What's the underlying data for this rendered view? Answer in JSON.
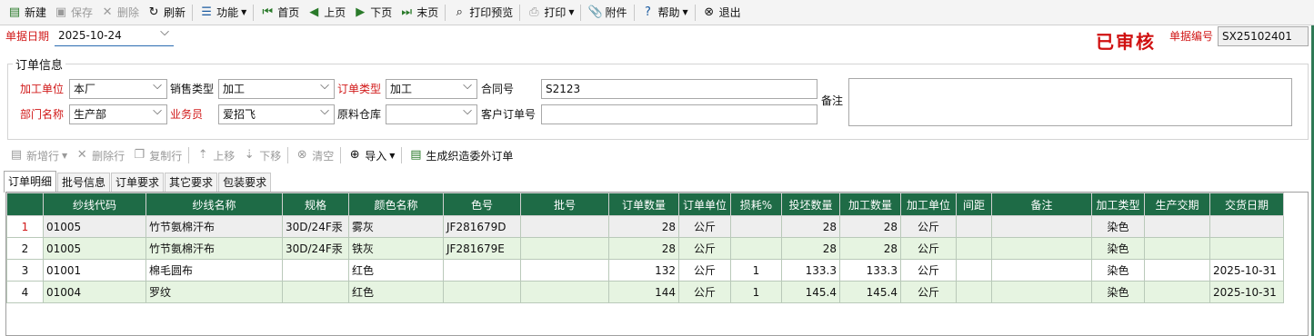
{
  "toolbar": {
    "new": "新建",
    "save": "保存",
    "delete": "删除",
    "refresh": "刷新",
    "function": "功能",
    "first": "首页",
    "prev": "上页",
    "next": "下页",
    "last": "末页",
    "print_preview": "打印预览",
    "print": "打印",
    "attachment": "附件",
    "help": "帮助",
    "exit": "退出"
  },
  "header": {
    "doc_date_label": "单据日期",
    "doc_date_value": "2025-10-24",
    "status_stamp": "已审核",
    "doc_no_label": "单据编号",
    "doc_no_value": "SX25102401"
  },
  "order_info": {
    "legend": "订单信息",
    "processing_unit_label": "加工单位",
    "processing_unit_value": "本厂",
    "sales_type_label": "销售类型",
    "sales_type_value": "加工",
    "order_type_label": "订单类型",
    "order_type_value": "加工",
    "contract_no_label": "合同号",
    "contract_no_value": "S2123",
    "remark_label": "备注",
    "remark_value": "",
    "dept_label": "部门名称",
    "dept_value": "生产部",
    "salesman_label": "业务员",
    "salesman_value": "爱招飞",
    "warehouse_label": "原料仓库",
    "warehouse_value": "",
    "customer_order_label": "客户订单号",
    "customer_order_value": ""
  },
  "detail_toolbar": {
    "add_row": "新增行",
    "delete_row": "删除行",
    "copy_row": "复制行",
    "move_up": "上移",
    "move_down": "下移",
    "clear": "清空",
    "import": "导入",
    "generate": "生成织造委外订单"
  },
  "tabs": [
    "订单明细",
    "批号信息",
    "订单要求",
    "其它要求",
    "包装要求"
  ],
  "grid": {
    "columns": [
      "纱线代码",
      "纱线名称",
      "规格",
      "颜色名称",
      "色号",
      "批号",
      "订单数量",
      "订单单位",
      "损耗%",
      "投坯数量",
      "加工数量",
      "加工单位",
      "间距",
      "备注",
      "加工类型",
      "生产交期",
      "交货日期"
    ],
    "rows": [
      [
        "1",
        "01005",
        "竹节氨棉汗布",
        "30D/24F汞",
        "雾灰",
        "JF281679D",
        "",
        "28",
        "公斤",
        "",
        "28",
        "28",
        "公斤",
        "",
        "",
        "染色",
        "",
        ""
      ],
      [
        "2",
        "01005",
        "竹节氨棉汗布",
        "30D/24F汞",
        "铁灰",
        "JF281679E",
        "",
        "28",
        "公斤",
        "",
        "28",
        "28",
        "公斤",
        "",
        "",
        "染色",
        "",
        ""
      ],
      [
        "3",
        "01001",
        "棉毛圆布",
        "",
        "红色",
        "",
        "",
        "132",
        "公斤",
        "1",
        "133.3",
        "133.3",
        "公斤",
        "",
        "",
        "染色",
        "",
        "2025-10-31"
      ],
      [
        "4",
        "01004",
        "罗纹",
        "",
        "红色",
        "",
        "",
        "144",
        "公斤",
        "1",
        "145.4",
        "145.4",
        "公斤",
        "",
        "",
        "染色",
        "",
        "2025-10-31"
      ]
    ]
  },
  "colors": {
    "accent": "#1e6b46",
    "required_label": "#d11818",
    "stamp": "#d01010",
    "row_alt": "#e6f4e1"
  }
}
